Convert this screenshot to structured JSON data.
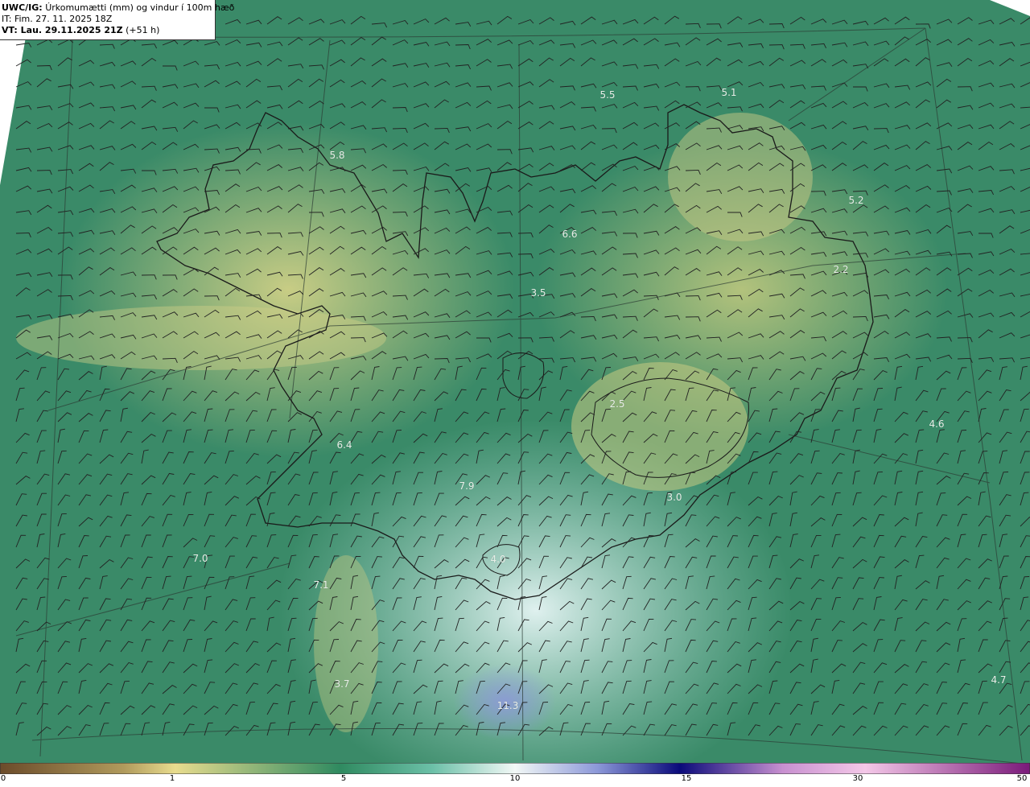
{
  "header": {
    "model_label": "UWC/IG:",
    "title": "Úrkomumætti (mm) og vindur í 100m hæð",
    "it_line": "IT: Fim. 27. 11. 2025 18Z",
    "vt_label": "VT: Lau. 29.11.2025 21Z",
    "vt_offset": "(+51 h)"
  },
  "value_labels": [
    {
      "text": "5.5"
    },
    {
      "text": "5.1"
    },
    {
      "text": "5.8"
    },
    {
      "text": "5.2"
    },
    {
      "text": "6.6"
    },
    {
      "text": "3.5"
    },
    {
      "text": "2.2"
    },
    {
      "text": "2.5"
    },
    {
      "text": "4.6"
    },
    {
      "text": "6.4"
    },
    {
      "text": "7.9"
    },
    {
      "text": "3.0"
    },
    {
      "text": "7.0"
    },
    {
      "text": "4.0"
    },
    {
      "text": "7.1"
    },
    {
      "text": "3.7"
    },
    {
      "text": "11.3"
    },
    {
      "text": "4.7"
    }
  ],
  "colorbar": {
    "unit": "mm",
    "ticks": [
      "0",
      "1",
      "5",
      "10",
      "15",
      "30",
      "50"
    ],
    "colors": [
      "#6b4b2a",
      "#c9b070",
      "#e8dc8e",
      "#2f8a60",
      "#a8e0d0",
      "#f2f8f6",
      "#0a0a7a",
      "#d8a0d8",
      "#7a1a7a"
    ]
  }
}
